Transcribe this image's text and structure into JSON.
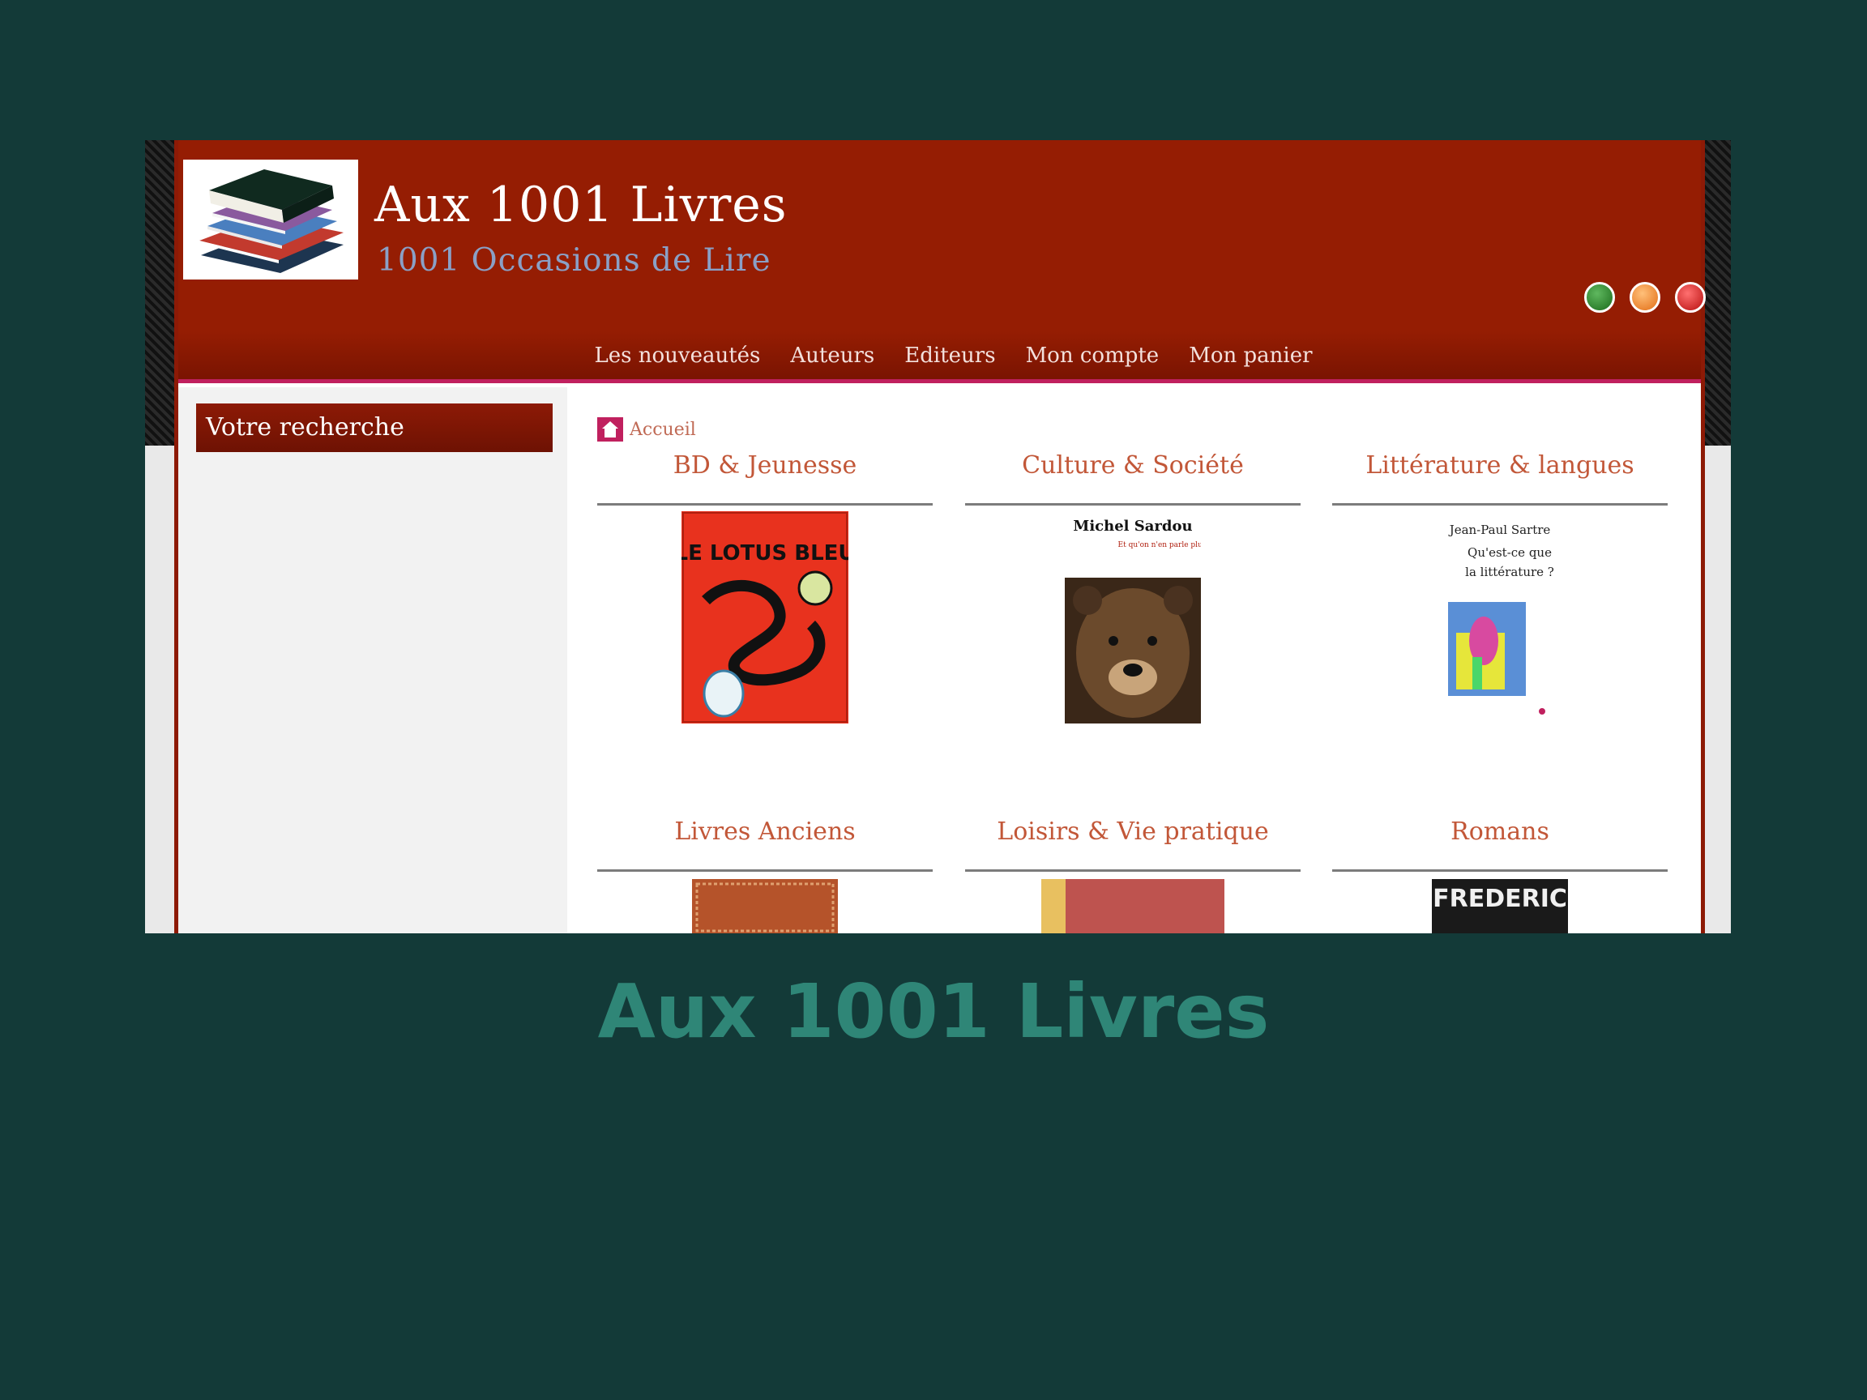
{
  "site": {
    "title": "Aux 1001 Livres",
    "subtitle": "1001 Occasions de Lire"
  },
  "nav": {
    "items": [
      {
        "label": "Les nouveautés"
      },
      {
        "label": "Auteurs"
      },
      {
        "label": "Editeurs"
      },
      {
        "label": "Mon compte"
      },
      {
        "label": "Mon panier"
      }
    ]
  },
  "sidebar": {
    "heading": "Votre recherche"
  },
  "breadcrumb": {
    "label": "Accueil"
  },
  "categories": [
    {
      "title": "BD & Jeunesse",
      "cover_text": "LE LOTUS BLEU"
    },
    {
      "title": "Culture & Société",
      "cover_author": "Michel Sardou",
      "cover_text": "Et qu'on n'en parle plus"
    },
    {
      "title": "Littérature & langues",
      "cover_author": "Jean-Paul Sartre",
      "cover_text_1": "Qu'est-ce que",
      "cover_text_2": "la littérature ?"
    },
    {
      "title": "Livres Anciens"
    },
    {
      "title": "Loisirs & Vie pratique"
    },
    {
      "title": "Romans",
      "cover_text": "FREDERIC"
    }
  ],
  "caption": "Aux 1001 Livres",
  "colors": {
    "background": "#133a38",
    "header": "#951d03",
    "accent_text": "#c25738",
    "caption": "#2f8677"
  }
}
